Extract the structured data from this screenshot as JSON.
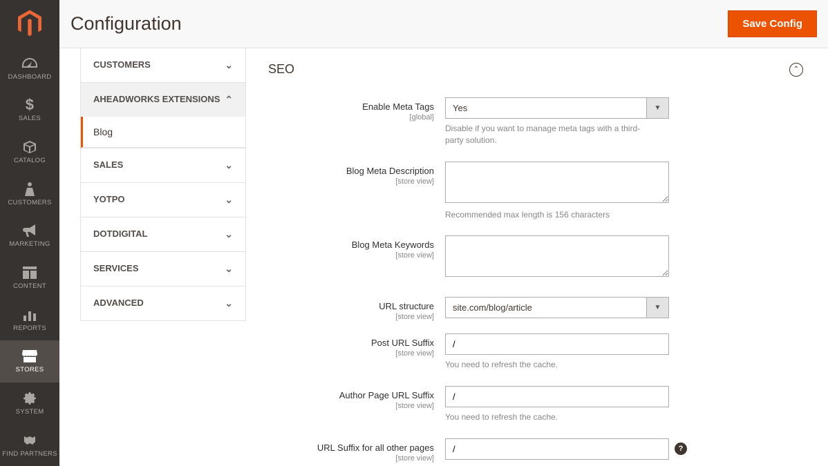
{
  "page": {
    "title": "Configuration",
    "save_button": "Save Config"
  },
  "admin_nav": {
    "items": [
      {
        "label": "DASHBOARD",
        "icon": "gauge"
      },
      {
        "label": "SALES",
        "icon": "dollar"
      },
      {
        "label": "CATALOG",
        "icon": "box"
      },
      {
        "label": "CUSTOMERS",
        "icon": "person"
      },
      {
        "label": "MARKETING",
        "icon": "bullhorn"
      },
      {
        "label": "CONTENT",
        "icon": "layout"
      },
      {
        "label": "REPORTS",
        "icon": "bars"
      },
      {
        "label": "STORES",
        "icon": "storefront",
        "active": true
      },
      {
        "label": "SYSTEM",
        "icon": "gear"
      },
      {
        "label": "FIND PARTNERS",
        "icon": "handshake"
      }
    ]
  },
  "config_nav": {
    "sections": [
      {
        "title": "CUSTOMERS",
        "expanded": false
      },
      {
        "title": "AHEADWORKS EXTENSIONS",
        "expanded": true,
        "items": [
          {
            "label": "Blog",
            "active": true
          }
        ]
      },
      {
        "title": "SALES",
        "expanded": false
      },
      {
        "title": "YOTPO",
        "expanded": false
      },
      {
        "title": "DOTDIGITAL",
        "expanded": false
      },
      {
        "title": "SERVICES",
        "expanded": false
      },
      {
        "title": "ADVANCED",
        "expanded": false
      }
    ]
  },
  "form": {
    "section_title": "SEO",
    "fields": {
      "enable_meta_tags": {
        "label": "Enable Meta Tags",
        "scope": "[global]",
        "value": "Yes",
        "note": "Disable if you want to manage meta tags with a third-party solution."
      },
      "blog_meta_description": {
        "label": "Blog Meta Description",
        "scope": "[store view]",
        "value": "",
        "note": "Recommended max length is 156 characters"
      },
      "blog_meta_keywords": {
        "label": "Blog Meta Keywords",
        "scope": "[store view]",
        "value": ""
      },
      "url_structure": {
        "label": "URL structure",
        "scope": "[store view]",
        "value": "site.com/blog/article"
      },
      "post_url_suffix": {
        "label": "Post URL Suffix",
        "scope": "[store view]",
        "value": "/",
        "note": "You need to refresh the cache."
      },
      "author_page_url_suffix": {
        "label": "Author Page URL Suffix",
        "scope": "[store view]",
        "value": "/",
        "note": "You need to refresh the cache."
      },
      "url_suffix_other": {
        "label": "URL Suffix for all other pages",
        "scope": "[store view]",
        "value": "/"
      }
    }
  }
}
